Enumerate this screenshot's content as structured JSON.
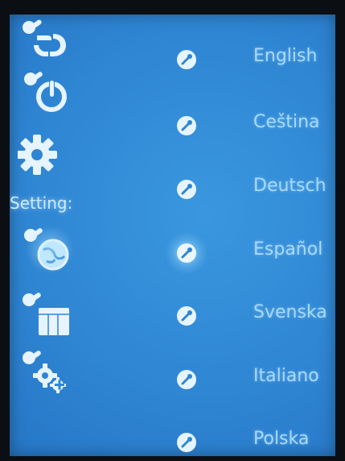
{
  "sidebar": {
    "label": "Setting:",
    "items": [
      {
        "icon": "wrench-hands-icon"
      },
      {
        "icon": "wrench-power-icon"
      },
      {
        "icon": "gear-icon"
      },
      {
        "icon": "wrench-globe-icon",
        "selected": true
      },
      {
        "icon": "wrench-calendar-icon"
      },
      {
        "icon": "wrench-gears-add-icon"
      }
    ]
  },
  "languages": [
    {
      "label": "English"
    },
    {
      "label": "Ceština"
    },
    {
      "label": "Deutsch"
    },
    {
      "label": "Español",
      "selected": true
    },
    {
      "label": "Svenska"
    },
    {
      "label": "Italiano"
    },
    {
      "label": "Polska"
    }
  ],
  "colors": {
    "screen": "#2f86d3",
    "text": "#a9d9ff",
    "icon": "#e6f4ff"
  }
}
